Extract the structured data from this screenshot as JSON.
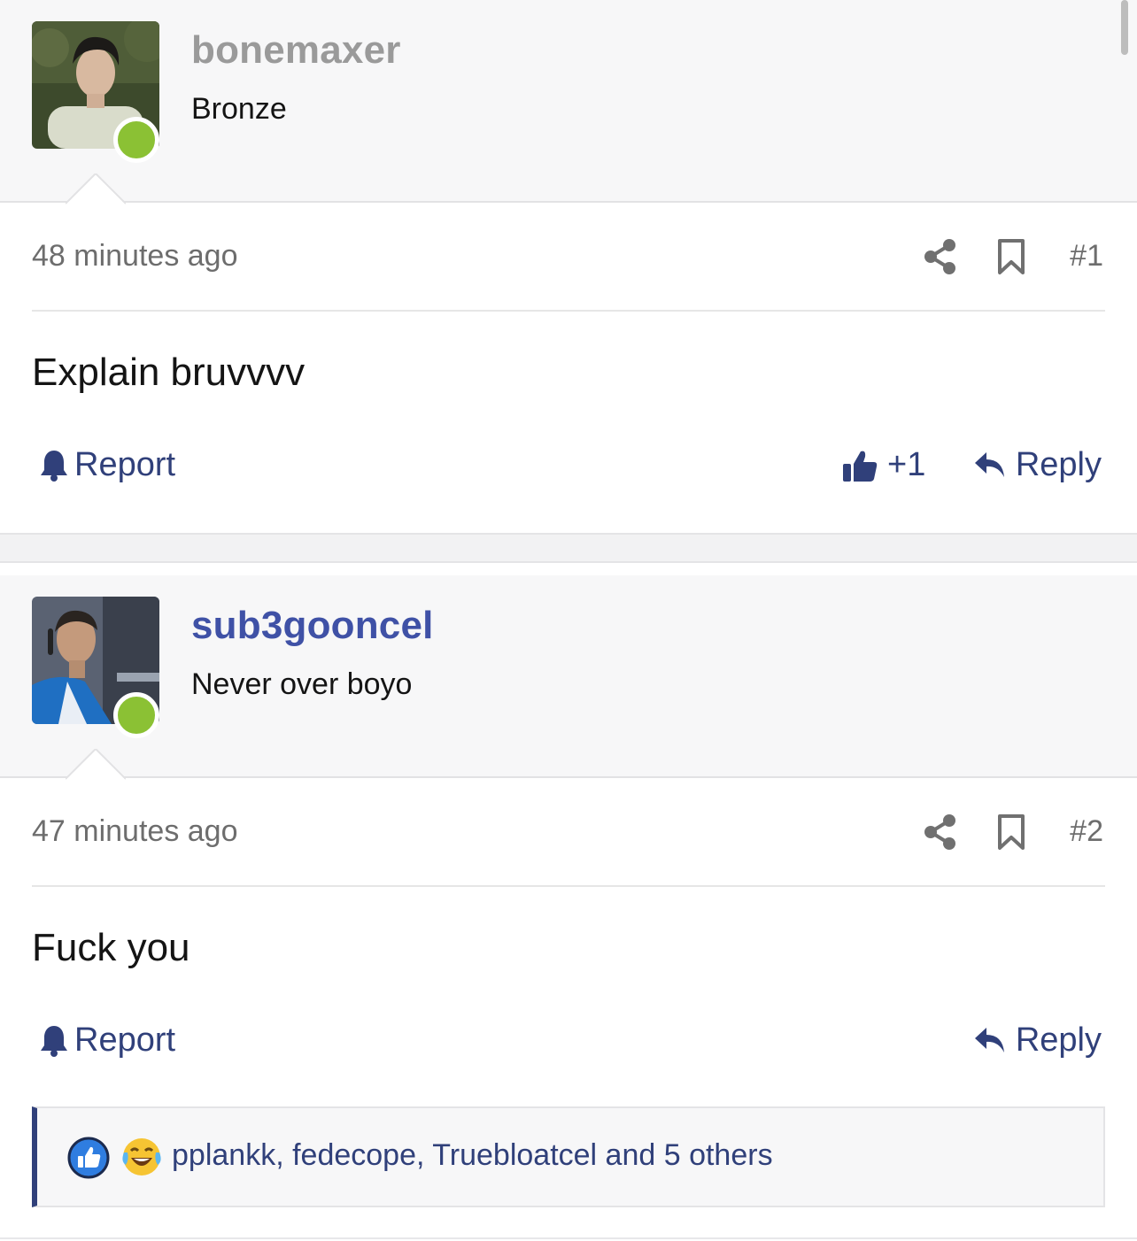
{
  "posts": [
    {
      "username": "bonemaxer",
      "user_title": "Bronze",
      "timestamp": "48 minutes ago",
      "post_number": "#1",
      "body": "Explain bruvvvv",
      "report_label": "Report",
      "like_count": "+1",
      "reply_label": "Reply",
      "online": true
    },
    {
      "username": "sub3gooncel",
      "user_title": "Never over boyo",
      "timestamp": "47 minutes ago",
      "post_number": "#2",
      "body": "Fuck you",
      "report_label": "Report",
      "reply_label": "Reply",
      "online": true,
      "reactions": {
        "icons": [
          "like-icon",
          "laugh-cry-icon"
        ],
        "text": "pplankk, fedecope, Truebloatcel and 5 others"
      }
    }
  ],
  "colors": {
    "accent": "#30407a",
    "username_blue": "#3f51a6",
    "username_gray": "#9a9a9a",
    "online": "#8bc134"
  }
}
